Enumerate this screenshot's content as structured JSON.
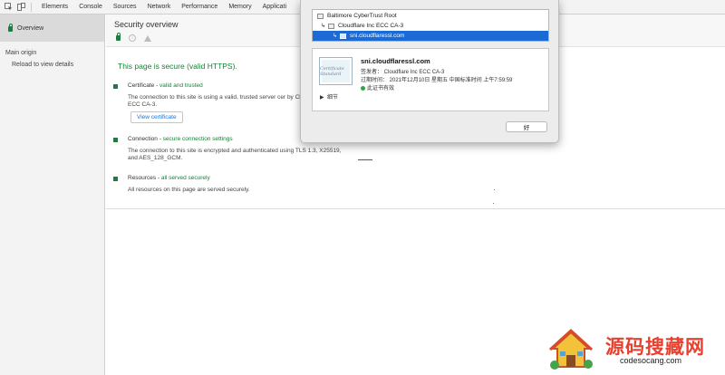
{
  "toolbar": {
    "tabs": [
      "Elements",
      "Console",
      "Sources",
      "Network",
      "Performance",
      "Memory",
      "Applicati"
    ]
  },
  "sidebar": {
    "overview_label": "Overview",
    "main_origin_label": "Main origin",
    "reload_label": "Reload to view details"
  },
  "main": {
    "title": "Security overview",
    "summary": "This page is secure (valid HTTPS).",
    "certificate": {
      "title": "Certificate",
      "status": "valid and trusted",
      "description": "The connection to this site is using a valid, trusted server cer by Cloudflare Inc ECC CA-3.",
      "button_label": "View certificate"
    },
    "connection": {
      "title": "Connection",
      "status": "secure connection settings",
      "description": "The connection to this site is encrypted and authenticated using TLS 1.3, X25519, and AES_128_GCM."
    },
    "resources": {
      "title": "Resources",
      "status": "all served securely",
      "description": "All resources on this page are served securely."
    }
  },
  "dialog": {
    "chain": [
      "Baltimore CyberTrust Root",
      "Cloudflare Inc ECC CA-3",
      "sni.cloudflaressl.com"
    ],
    "cert_image_text": "Certificate Standard",
    "cert_name": "sni.cloudflaressl.com",
    "issuer": "签发者： Cloudflare Inc ECC CA-3",
    "expires": "过期时间： 2021年12月10日 星期五 中国标准时间 上午7:59:59",
    "valid_text": "此证书有效",
    "details_label": "细节",
    "ok_label": "好"
  },
  "watermark": {
    "cn_text": "源码搜藏网",
    "url": "codesocang.com"
  },
  "colors": {
    "secure_green": "#188038",
    "selection_blue": "#1c6bd5",
    "link_blue": "#1a73e8",
    "watermark_red": "#e8402f"
  }
}
